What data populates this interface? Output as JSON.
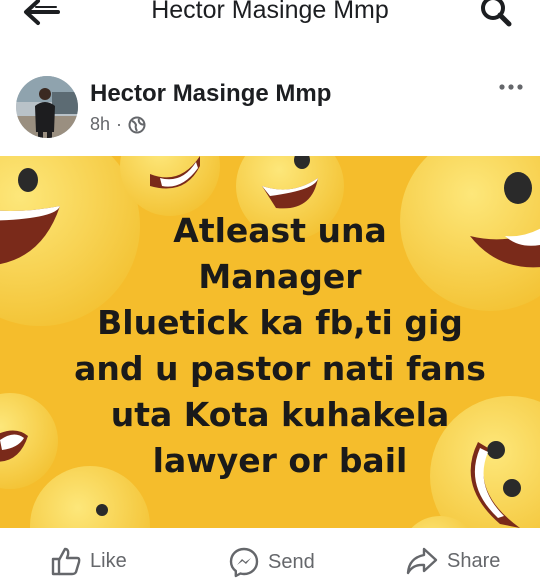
{
  "topbar": {
    "title": "Hector Masinge Mmp",
    "back_icon": "back-arrow-icon",
    "search_icon": "search-icon"
  },
  "post": {
    "author": "Hector Masinge Mmp",
    "time": "8h",
    "separator": "·",
    "audience_icon": "globe-icon",
    "more_icon": "more-dots-icon",
    "image": {
      "background_color": "#f5bd2c",
      "lines": [
        "Atleast una",
        "Manager",
        "Bluetick ka fb,ti gig",
        "and u pastor nati fans",
        "uta Kota kuhakela",
        "lawyer or bail"
      ]
    }
  },
  "actions": {
    "like_label": "Like",
    "send_label": "Send",
    "share_label": "Share"
  }
}
